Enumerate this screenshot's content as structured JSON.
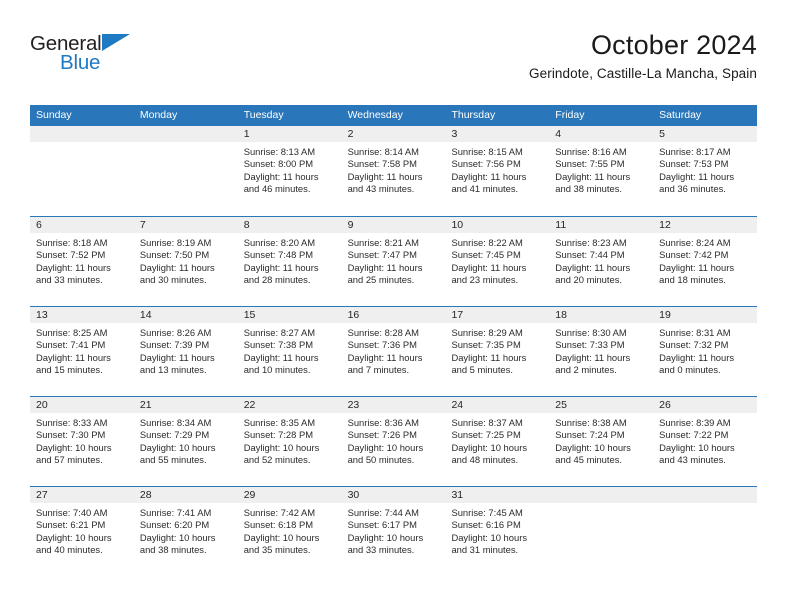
{
  "brand": {
    "name_part1": "General",
    "name_part2": "Blue",
    "triangle_color": "#1f7ac4"
  },
  "header": {
    "title": "October 2024",
    "subtitle": "Gerindote, Castille-La Mancha, Spain"
  },
  "theme": {
    "header_blue": "#2a76ba",
    "band_gray": "#efefef",
    "text": "#1a1a1a"
  },
  "calendar": {
    "weekday_headers": [
      "Sunday",
      "Monday",
      "Tuesday",
      "Wednesday",
      "Thursday",
      "Friday",
      "Saturday"
    ],
    "weeks": [
      [
        {
          "day": "",
          "sunrise": "",
          "sunset": "",
          "daylight_line1": "",
          "daylight_line2": ""
        },
        {
          "day": "",
          "sunrise": "",
          "sunset": "",
          "daylight_line1": "",
          "daylight_line2": ""
        },
        {
          "day": "1",
          "sunrise": "Sunrise: 8:13 AM",
          "sunset": "Sunset: 8:00 PM",
          "daylight_line1": "Daylight: 11 hours",
          "daylight_line2": "and 46 minutes."
        },
        {
          "day": "2",
          "sunrise": "Sunrise: 8:14 AM",
          "sunset": "Sunset: 7:58 PM",
          "daylight_line1": "Daylight: 11 hours",
          "daylight_line2": "and 43 minutes."
        },
        {
          "day": "3",
          "sunrise": "Sunrise: 8:15 AM",
          "sunset": "Sunset: 7:56 PM",
          "daylight_line1": "Daylight: 11 hours",
          "daylight_line2": "and 41 minutes."
        },
        {
          "day": "4",
          "sunrise": "Sunrise: 8:16 AM",
          "sunset": "Sunset: 7:55 PM",
          "daylight_line1": "Daylight: 11 hours",
          "daylight_line2": "and 38 minutes."
        },
        {
          "day": "5",
          "sunrise": "Sunrise: 8:17 AM",
          "sunset": "Sunset: 7:53 PM",
          "daylight_line1": "Daylight: 11 hours",
          "daylight_line2": "and 36 minutes."
        }
      ],
      [
        {
          "day": "6",
          "sunrise": "Sunrise: 8:18 AM",
          "sunset": "Sunset: 7:52 PM",
          "daylight_line1": "Daylight: 11 hours",
          "daylight_line2": "and 33 minutes."
        },
        {
          "day": "7",
          "sunrise": "Sunrise: 8:19 AM",
          "sunset": "Sunset: 7:50 PM",
          "daylight_line1": "Daylight: 11 hours",
          "daylight_line2": "and 30 minutes."
        },
        {
          "day": "8",
          "sunrise": "Sunrise: 8:20 AM",
          "sunset": "Sunset: 7:48 PM",
          "daylight_line1": "Daylight: 11 hours",
          "daylight_line2": "and 28 minutes."
        },
        {
          "day": "9",
          "sunrise": "Sunrise: 8:21 AM",
          "sunset": "Sunset: 7:47 PM",
          "daylight_line1": "Daylight: 11 hours",
          "daylight_line2": "and 25 minutes."
        },
        {
          "day": "10",
          "sunrise": "Sunrise: 8:22 AM",
          "sunset": "Sunset: 7:45 PM",
          "daylight_line1": "Daylight: 11 hours",
          "daylight_line2": "and 23 minutes."
        },
        {
          "day": "11",
          "sunrise": "Sunrise: 8:23 AM",
          "sunset": "Sunset: 7:44 PM",
          "daylight_line1": "Daylight: 11 hours",
          "daylight_line2": "and 20 minutes."
        },
        {
          "day": "12",
          "sunrise": "Sunrise: 8:24 AM",
          "sunset": "Sunset: 7:42 PM",
          "daylight_line1": "Daylight: 11 hours",
          "daylight_line2": "and 18 minutes."
        }
      ],
      [
        {
          "day": "13",
          "sunrise": "Sunrise: 8:25 AM",
          "sunset": "Sunset: 7:41 PM",
          "daylight_line1": "Daylight: 11 hours",
          "daylight_line2": "and 15 minutes."
        },
        {
          "day": "14",
          "sunrise": "Sunrise: 8:26 AM",
          "sunset": "Sunset: 7:39 PM",
          "daylight_line1": "Daylight: 11 hours",
          "daylight_line2": "and 13 minutes."
        },
        {
          "day": "15",
          "sunrise": "Sunrise: 8:27 AM",
          "sunset": "Sunset: 7:38 PM",
          "daylight_line1": "Daylight: 11 hours",
          "daylight_line2": "and 10 minutes."
        },
        {
          "day": "16",
          "sunrise": "Sunrise: 8:28 AM",
          "sunset": "Sunset: 7:36 PM",
          "daylight_line1": "Daylight: 11 hours",
          "daylight_line2": "and 7 minutes."
        },
        {
          "day": "17",
          "sunrise": "Sunrise: 8:29 AM",
          "sunset": "Sunset: 7:35 PM",
          "daylight_line1": "Daylight: 11 hours",
          "daylight_line2": "and 5 minutes."
        },
        {
          "day": "18",
          "sunrise": "Sunrise: 8:30 AM",
          "sunset": "Sunset: 7:33 PM",
          "daylight_line1": "Daylight: 11 hours",
          "daylight_line2": "and 2 minutes."
        },
        {
          "day": "19",
          "sunrise": "Sunrise: 8:31 AM",
          "sunset": "Sunset: 7:32 PM",
          "daylight_line1": "Daylight: 11 hours",
          "daylight_line2": "and 0 minutes."
        }
      ],
      [
        {
          "day": "20",
          "sunrise": "Sunrise: 8:33 AM",
          "sunset": "Sunset: 7:30 PM",
          "daylight_line1": "Daylight: 10 hours",
          "daylight_line2": "and 57 minutes."
        },
        {
          "day": "21",
          "sunrise": "Sunrise: 8:34 AM",
          "sunset": "Sunset: 7:29 PM",
          "daylight_line1": "Daylight: 10 hours",
          "daylight_line2": "and 55 minutes."
        },
        {
          "day": "22",
          "sunrise": "Sunrise: 8:35 AM",
          "sunset": "Sunset: 7:28 PM",
          "daylight_line1": "Daylight: 10 hours",
          "daylight_line2": "and 52 minutes."
        },
        {
          "day": "23",
          "sunrise": "Sunrise: 8:36 AM",
          "sunset": "Sunset: 7:26 PM",
          "daylight_line1": "Daylight: 10 hours",
          "daylight_line2": "and 50 minutes."
        },
        {
          "day": "24",
          "sunrise": "Sunrise: 8:37 AM",
          "sunset": "Sunset: 7:25 PM",
          "daylight_line1": "Daylight: 10 hours",
          "daylight_line2": "and 48 minutes."
        },
        {
          "day": "25",
          "sunrise": "Sunrise: 8:38 AM",
          "sunset": "Sunset: 7:24 PM",
          "daylight_line1": "Daylight: 10 hours",
          "daylight_line2": "and 45 minutes."
        },
        {
          "day": "26",
          "sunrise": "Sunrise: 8:39 AM",
          "sunset": "Sunset: 7:22 PM",
          "daylight_line1": "Daylight: 10 hours",
          "daylight_line2": "and 43 minutes."
        }
      ],
      [
        {
          "day": "27",
          "sunrise": "Sunrise: 7:40 AM",
          "sunset": "Sunset: 6:21 PM",
          "daylight_line1": "Daylight: 10 hours",
          "daylight_line2": "and 40 minutes."
        },
        {
          "day": "28",
          "sunrise": "Sunrise: 7:41 AM",
          "sunset": "Sunset: 6:20 PM",
          "daylight_line1": "Daylight: 10 hours",
          "daylight_line2": "and 38 minutes."
        },
        {
          "day": "29",
          "sunrise": "Sunrise: 7:42 AM",
          "sunset": "Sunset: 6:18 PM",
          "daylight_line1": "Daylight: 10 hours",
          "daylight_line2": "and 35 minutes."
        },
        {
          "day": "30",
          "sunrise": "Sunrise: 7:44 AM",
          "sunset": "Sunset: 6:17 PM",
          "daylight_line1": "Daylight: 10 hours",
          "daylight_line2": "and 33 minutes."
        },
        {
          "day": "31",
          "sunrise": "Sunrise: 7:45 AM",
          "sunset": "Sunset: 6:16 PM",
          "daylight_line1": "Daylight: 10 hours",
          "daylight_line2": "and 31 minutes."
        },
        {
          "day": "",
          "sunrise": "",
          "sunset": "",
          "daylight_line1": "",
          "daylight_line2": ""
        },
        {
          "day": "",
          "sunrise": "",
          "sunset": "",
          "daylight_line1": "",
          "daylight_line2": ""
        }
      ]
    ]
  }
}
